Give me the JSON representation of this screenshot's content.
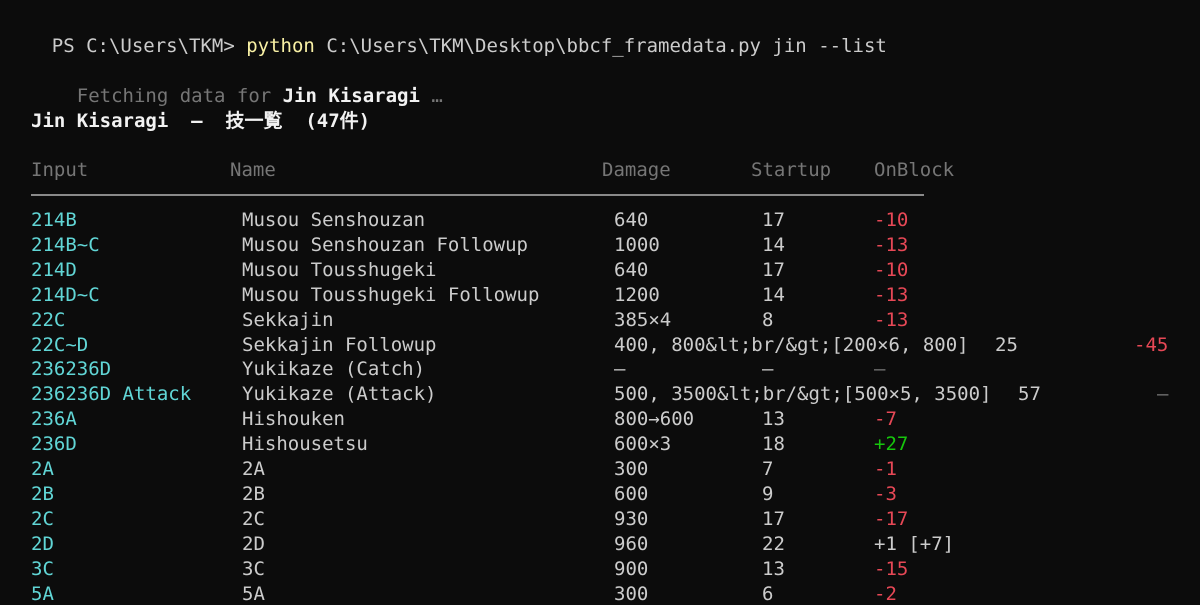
{
  "prompt": {
    "ps": "PS C:\\Users\\TKM> ",
    "command": "python",
    "args": " C:\\Users\\TKM\\Desktop\\bbcf_framedata.py jin --list"
  },
  "fetch": {
    "prefix": "Fetching data for ",
    "character": "Jin Kisaragi",
    "suffix": " …"
  },
  "title": "Jin Kisaragi  –  技一覧  (47件)",
  "headers": {
    "input": "Input",
    "name": "Name",
    "damage": "Damage",
    "startup": "Startup",
    "onblock": "OnBlock"
  },
  "rows": [
    {
      "input": "214B",
      "name": "Musou Senshouzan",
      "damage": "640",
      "startup": "17",
      "onblock": "-10",
      "tone": "neg"
    },
    {
      "input": "214B~C",
      "name": "Musou Senshouzan Followup",
      "damage": "1000",
      "startup": "14",
      "onblock": "-13",
      "tone": "neg"
    },
    {
      "input": "214D",
      "name": "Musou Tousshugeki",
      "damage": "640",
      "startup": "17",
      "onblock": "-10",
      "tone": "neg"
    },
    {
      "input": "214D~C",
      "name": "Musou Tousshugeki Followup",
      "damage": "1200",
      "startup": "14",
      "onblock": "-13",
      "tone": "neg"
    },
    {
      "input": "22C",
      "name": "Sekkajin",
      "damage": "385×4",
      "startup": "8",
      "onblock": "-13",
      "tone": "neg"
    },
    {
      "input": "22C~D",
      "name": "Sekkajin Followup",
      "damage": "400, 800&lt;br/&gt;[200×6, 800]",
      "startup": "25",
      "onblock": "-45",
      "tone": "neg",
      "overflow": true
    },
    {
      "input": "236236D",
      "name": "Yukikaze (Catch)",
      "damage": "–",
      "startup": "–",
      "onblock": "–",
      "tone": "none"
    },
    {
      "input": "236236D Attack",
      "name": "Yukikaze (Attack)",
      "damage": "500, 3500&lt;br/&gt;[500×5, 3500]",
      "startup": "57",
      "onblock": "–",
      "tone": "none",
      "overflow": true
    },
    {
      "input": "236A",
      "name": "Hishouken",
      "damage": "800→600",
      "startup": "13",
      "onblock": "-7",
      "tone": "neg"
    },
    {
      "input": "236D",
      "name": "Hishousetsu",
      "damage": "600×3",
      "startup": "18",
      "onblock": "+27",
      "tone": "pos"
    },
    {
      "input": "2A",
      "name": "2A",
      "damage": "300",
      "startup": "7",
      "onblock": "-1",
      "tone": "neg"
    },
    {
      "input": "2B",
      "name": "2B",
      "damage": "600",
      "startup": "9",
      "onblock": "-3",
      "tone": "neg"
    },
    {
      "input": "2C",
      "name": "2C",
      "damage": "930",
      "startup": "17",
      "onblock": "-17",
      "tone": "neg"
    },
    {
      "input": "2D",
      "name": "2D",
      "damage": "960",
      "startup": "22",
      "onblock": "+1 [+7]",
      "tone": "neu"
    },
    {
      "input": "3C",
      "name": "3C",
      "damage": "900",
      "startup": "13",
      "onblock": "-15",
      "tone": "neg"
    },
    {
      "input": "5A",
      "name": "5A",
      "damage": "300",
      "startup": "6",
      "onblock": "-2",
      "tone": "neg"
    }
  ],
  "colors": {
    "background": "#0c0c0c",
    "input": "#61d6d6",
    "negative": "#e74856",
    "positive": "#16c60c",
    "command": "#f9f1a5"
  }
}
